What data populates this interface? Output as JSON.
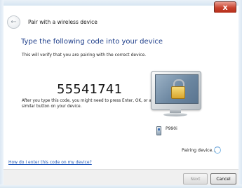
{
  "window": {
    "title": "Pair with a wireless device",
    "close_label": "x"
  },
  "header": {
    "back_glyph": "←",
    "title": "Pair with a wireless device"
  },
  "main": {
    "heading": "Type the following code into your device",
    "subtext": "This will verify that you are pairing with the correct device.",
    "code": "55541741",
    "instruction": "After you type this code, you might need to press Enter, OK, or a similar button on your device.",
    "device_name": "P990i",
    "status": "Pairing device...",
    "help_link": "How do I enter this code on my device?"
  },
  "footer": {
    "next_label": "Next",
    "cancel_label": "Cancel"
  },
  "icons": {
    "monitor": "monitor-lock-icon",
    "device": "phone-icon",
    "spinner": "spinner-icon",
    "back": "back-arrow-icon"
  }
}
